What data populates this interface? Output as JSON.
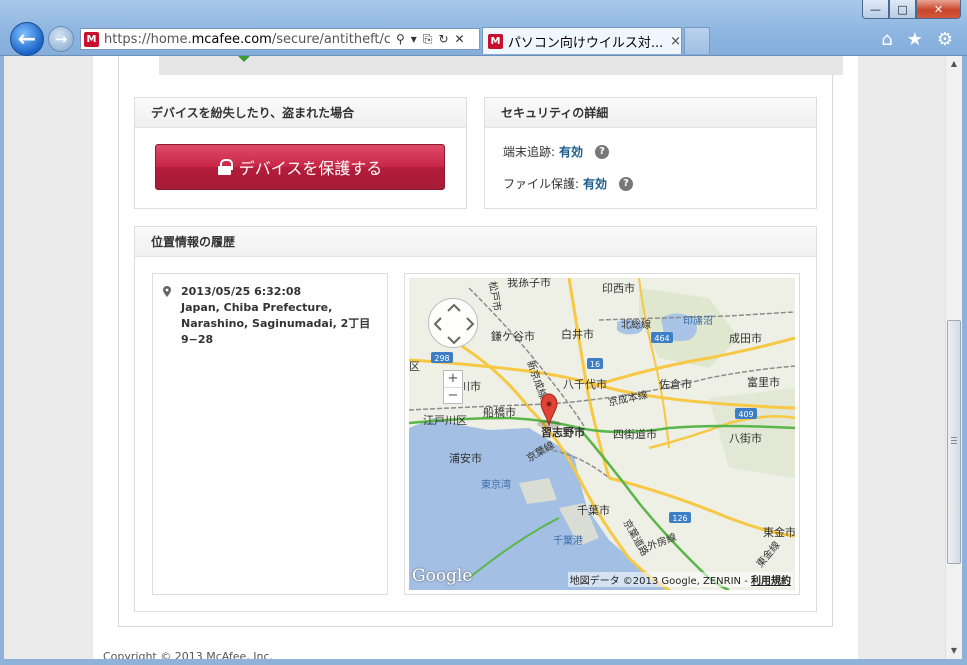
{
  "browser": {
    "url_prefix": "https://home.",
    "url_host": "mcafee.com",
    "url_path": "/secure/antitheft/consu",
    "tab_title": "パソコン向けウイルス対...",
    "tab_close": "×",
    "site_icon_letter": "M",
    "window_buttons": {
      "minimize": "—",
      "maximize": "□",
      "close": "✕"
    },
    "back_glyph": "←",
    "forward_glyph": "→",
    "addr_tools": [
      "⚲",
      "▾",
      "⎘",
      "↻",
      "✕"
    ],
    "right_tools": [
      "⌂",
      "★",
      "⚙"
    ]
  },
  "lost_panel": {
    "heading": "デバイスを紛失したり、盗まれた場合",
    "protect_button": "デバイスを保護する"
  },
  "security_panel": {
    "heading": "セキュリティの詳細",
    "tracking_label": "端末追跡:",
    "tracking_value": "有効",
    "file_label": "ファイル保護:",
    "file_value": "有効",
    "help_glyph": "?"
  },
  "history_panel": {
    "heading": "位置情報の履歴",
    "entry": {
      "timestamp": "2013/05/25 6:32:08",
      "line1": "Japan, Chiba Prefecture,",
      "line2": "Narashino, Saginumadai, 2丁目",
      "line3": "9−28"
    }
  },
  "map": {
    "zoom_in": "+",
    "zoom_out": "−",
    "google_logo": "Google",
    "attribution": "地図データ ©2013 Google, ZENRIN - ",
    "terms": "利用規約",
    "labels": {
      "abiko": "我孫子市",
      "inzai": "印西市",
      "kamagaya": "鎌ケ谷市",
      "shiroi": "白井市",
      "kitasosen": "北総線",
      "inba": "印旛沼",
      "narita": "成田市",
      "yachiyo": "八千代市",
      "sakura": "佐倉市",
      "tomisato": "富里市",
      "ichikawa": "川市",
      "funabashi": "船橋市",
      "keisei": "京成本線",
      "edogawa": "江戸川区",
      "narashino": "習志野市",
      "yotsukaido": "四街道市",
      "yachimata": "八街市",
      "urayasu": "浦安市",
      "keiyo": "京葉線",
      "tokyowan": "東京湾",
      "chiba": "千葉市",
      "chibako": "千葉港",
      "sotobo": "外房線",
      "togane": "東金市",
      "matsudo": "松戸市",
      "shinkeisei": "新京成線",
      "ku": "区",
      "keiyo_road": "京葉道路",
      "togane_line": "東金線",
      "r298": "298",
      "r16": "16",
      "r464": "464",
      "r409": "409",
      "r126": "126"
    }
  },
  "footer": {
    "copyright": "Copyright © 2013 McAfee, Inc."
  },
  "scrollbar": {
    "up": "▲",
    "down": "▼"
  }
}
